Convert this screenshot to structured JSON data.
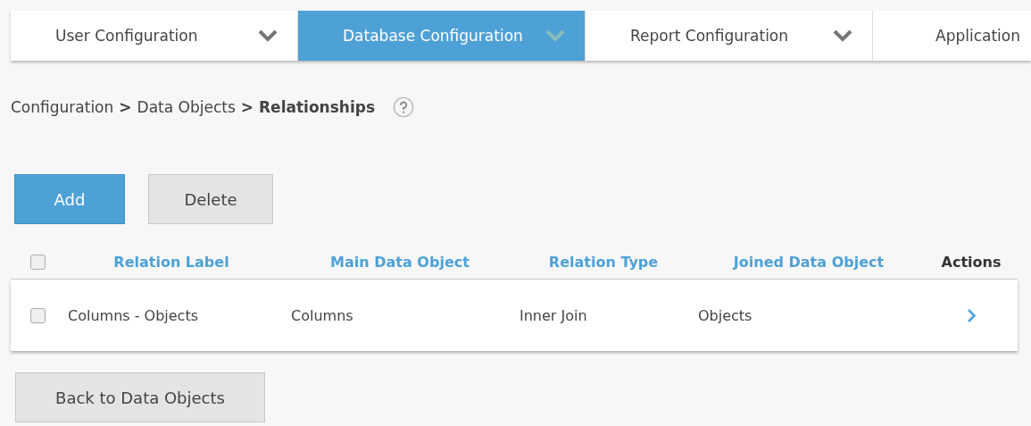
{
  "tabs": [
    {
      "label": "User Configuration",
      "selected": false,
      "caret": true
    },
    {
      "label": "Database Configuration",
      "selected": true,
      "caret": true
    },
    {
      "label": "Report Configuration",
      "selected": false,
      "caret": true
    },
    {
      "label": "Application",
      "selected": false,
      "caret": false
    }
  ],
  "breadcrumb": {
    "items": [
      "Configuration",
      "Data Objects"
    ],
    "current": "Relationships",
    "separator": ">"
  },
  "toolbar": {
    "buttons": [
      {
        "label": "Add",
        "kind": "primary"
      },
      {
        "label": "Delete",
        "kind": "secondary"
      }
    ]
  },
  "table": {
    "select_all": {
      "checked": false
    },
    "columns": [
      {
        "label": "Relation Label",
        "sortable": true
      },
      {
        "label": "Main Data Object",
        "sortable": true
      },
      {
        "label": "Relation Type",
        "sortable": true
      },
      {
        "label": "Joined Data Object",
        "sortable": true
      },
      {
        "label": "Actions",
        "sortable": false
      }
    ],
    "rows": [
      {
        "checked": false,
        "cells": [
          "Columns - Objects",
          "Columns",
          "Inner Join",
          "Objects"
        ]
      }
    ]
  },
  "footer_button": {
    "label": "Back to Data Objects"
  }
}
